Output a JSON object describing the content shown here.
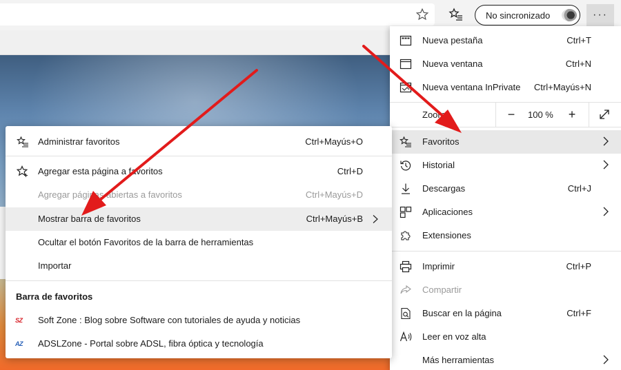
{
  "toolbar": {
    "sync_label": "No sincronizado",
    "more_label": "···"
  },
  "main_menu": {
    "items": [
      {
        "label": "Nueva pestaña",
        "shortcut": "Ctrl+T",
        "icon": "new-tab-icon"
      },
      {
        "label": "Nueva ventana",
        "shortcut": "Ctrl+N",
        "icon": "new-window-icon"
      },
      {
        "label": "Nueva ventana InPrivate",
        "shortcut": "Ctrl+Mayús+N",
        "icon": "inprivate-icon"
      }
    ],
    "zoom": {
      "label": "Zoom",
      "value": "100 %",
      "minus": "−",
      "plus": "+"
    },
    "items2": [
      {
        "label": "Favoritos",
        "shortcut": "",
        "icon": "favorites-icon"
      },
      {
        "label": "Historial",
        "shortcut": "",
        "icon": "history-icon"
      },
      {
        "label": "Descargas",
        "shortcut": "Ctrl+J",
        "icon": "download-icon"
      },
      {
        "label": "Aplicaciones",
        "shortcut": "",
        "icon": "apps-icon"
      },
      {
        "label": "Extensiones",
        "shortcut": "",
        "icon": "extensions-icon"
      }
    ],
    "items3": [
      {
        "label": "Imprimir",
        "shortcut": "Ctrl+P",
        "icon": "print-icon"
      },
      {
        "label": "Compartir",
        "shortcut": "",
        "icon": "share-icon"
      },
      {
        "label": "Buscar en la página",
        "shortcut": "Ctrl+F",
        "icon": "find-icon"
      },
      {
        "label": "Leer en voz alta",
        "shortcut": "",
        "icon": "read-aloud-icon"
      },
      {
        "label": "Más herramientas",
        "shortcut": "",
        "icon": ""
      }
    ]
  },
  "favorites_menu": {
    "items": [
      {
        "label": "Administrar favoritos",
        "shortcut": "Ctrl+Mayús+O"
      },
      {
        "label": "Agregar esta página a favoritos",
        "shortcut": "Ctrl+D"
      },
      {
        "label": "Agregar páginas abiertas a favoritos",
        "shortcut": "Ctrl+Mayús+D"
      },
      {
        "label": "Mostrar barra de favoritos",
        "shortcut": "Ctrl+Mayús+B"
      },
      {
        "label": "Ocultar el botón Favoritos de la barra de herramientas",
        "shortcut": ""
      },
      {
        "label": "Importar",
        "shortcut": ""
      }
    ],
    "heading": "Barra de favoritos",
    "bookmarks": [
      {
        "favicon": "SZ",
        "label": "Soft Zone : Blog sobre Software con tutoriales de ayuda y noticias"
      },
      {
        "favicon": "AZ",
        "label": "ADSLZone - Portal sobre ADSL, fibra óptica y tecnología"
      }
    ]
  },
  "colors": {
    "arrow": "#e21b1b",
    "highlight": "#e8e8e8",
    "softzone_red": "#d8232a",
    "adslzone_blue": "#2a62b8"
  }
}
